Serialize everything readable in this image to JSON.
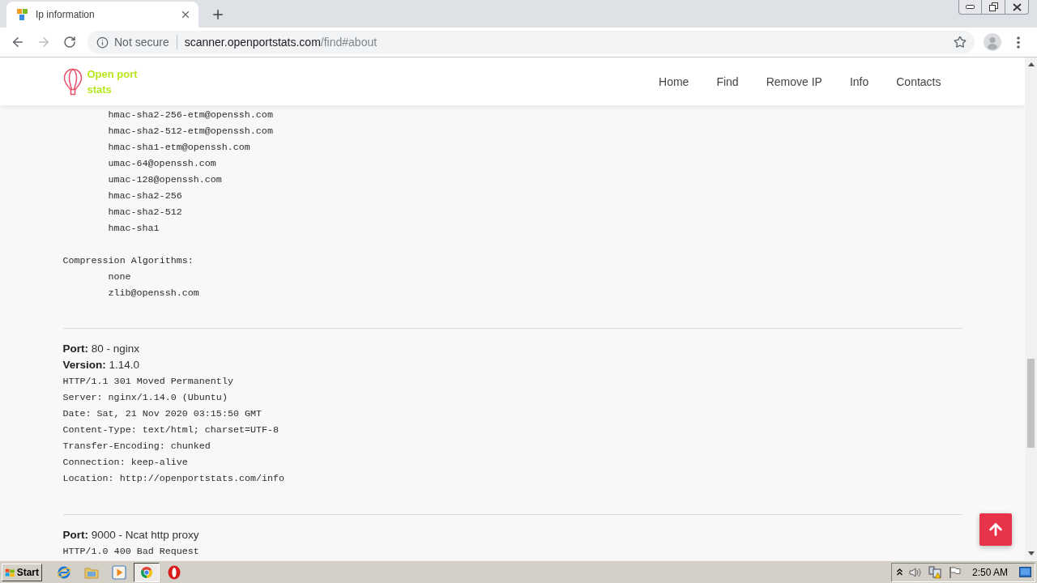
{
  "browser": {
    "tab": {
      "title": "Ip information",
      "selected": true
    },
    "forward": {
      "disabled": true
    },
    "address": {
      "security": "Not secure",
      "host": "scanner.openportstats.com",
      "path": "/find#about"
    }
  },
  "header": {
    "logo": "Open port stats",
    "nav": [
      "Home",
      "Find",
      "Remove IP",
      "Info",
      "Contacts"
    ]
  },
  "listing": [
    {
      "items": [
        "hmac-sha2-256-etm@openssh.com",
        "hmac-sha2-512-etm@openssh.com",
        "hmac-sha1-etm@openssh.com",
        "umac-64@openssh.com",
        "umac-128@openssh.com",
        "hmac-sha2-256",
        "hmac-sha2-512",
        "hmac-sha1"
      ]
    },
    {
      "heading": "Compression Algorithms:",
      "items": [
        "none",
        "zlib@openssh.com"
      ]
    }
  ],
  "ports": [
    {
      "title": "**Port:** 80 - nginx",
      "version": "**Version:** 1.14.0",
      "response": [
        "HTTP/1.1 301 Moved Permanently",
        "Server: nginx/1.14.0 (Ubuntu)",
        "Date: Sat, 21 Nov 2020 03:15:50 GMT",
        "Content-Type: text/html; charset=UTF-8",
        "Transfer-Encoding: chunked",
        "Connection: keep-alive",
        "Location: http://openportstats.com/info"
      ]
    },
    {
      "title": "**Port:** 9000 - Ncat http proxy",
      "response": [
        "HTTP/1.0 400 Bad Request"
      ]
    }
  ],
  "taskbar": {
    "start": "Start",
    "apps": [
      {
        "kind": "globe",
        "selected": false
      },
      {
        "kind": "folder",
        "selected": false
      },
      {
        "kind": "play",
        "selected": false
      },
      {
        "kind": "wheel",
        "selected": true
      },
      {
        "kind": "ring",
        "selected": false
      }
    ],
    "clock": "2:50 AM"
  }
}
